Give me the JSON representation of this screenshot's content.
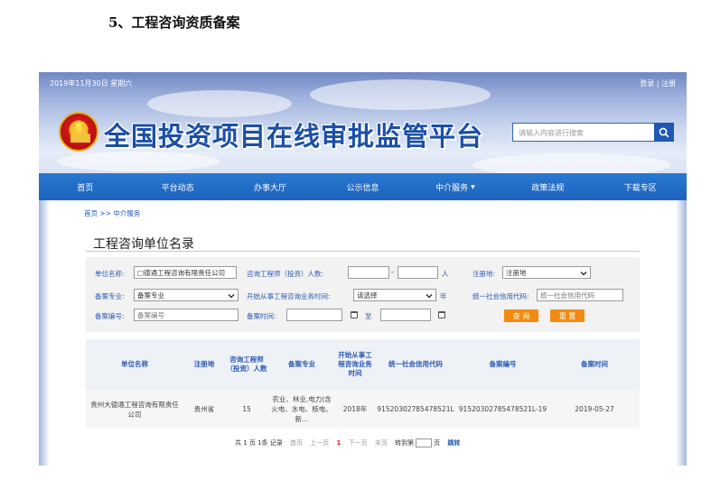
{
  "doc": {
    "heading": "5、工程咨询资质备案"
  },
  "banner": {
    "date": "2019年11月30日 星期六",
    "login": "登录",
    "separator": " | ",
    "register": "注册",
    "site_title": "全国投资项目在线审批监管平台",
    "search_placeholder": "请输入内容进行搜索"
  },
  "nav": {
    "items": [
      "首页",
      "平台动态",
      "办事大厅",
      "公示信息",
      "中介服务",
      "政策法规",
      "下载专区"
    ],
    "dropdown_arrow": "▼"
  },
  "breadcrumb": "首页 >> 中介服务",
  "page_title": "工程咨询单位名录",
  "filters": {
    "unit_name": {
      "label": "单位名称:",
      "value": "□德通工程咨询有限责任公司"
    },
    "engineer_count": {
      "label": "咨询工程师（投资）人数:",
      "dash": "-",
      "unit": "人"
    },
    "reg_place": {
      "label": "注册地:",
      "value": "注册地"
    },
    "filing_major": {
      "label": "备案专业:",
      "value": "备案专业"
    },
    "start_time": {
      "label": "开始从事工程咨询业务时间:",
      "value": "请选择",
      "unit": "年"
    },
    "credit_code": {
      "label": "统一社会信用代码:",
      "placeholder": "统一社会信用代码"
    },
    "filing_no": {
      "label": "备案编号:",
      "placeholder": "备案编号"
    },
    "filing_time": {
      "label": "备案时间:",
      "to": "至"
    },
    "query_button": "查 询",
    "reset_button": "重 置"
  },
  "table": {
    "headers": [
      "单位名称",
      "注册地",
      "咨询工程师（投资）人数",
      "备案专业",
      "开始从事工程咨询业务时间",
      "统一社会信用代码",
      "备案编号",
      "备案时间"
    ],
    "rows": [
      [
        "贵州大德通工程咨询有限责任公司",
        "贵州省",
        "15",
        "农业、林业,电力(含火电、水电、核电、新...",
        "2018年",
        "91520302785478521L",
        "91520302785478521L-19",
        "2019-05-27"
      ]
    ]
  },
  "pager": {
    "summary": "共 1 页 1条 记录",
    "first": "首页",
    "prev": "上一页",
    "current": "1",
    "next": "下一页",
    "last": "末页",
    "jump_label": "转到第",
    "page_suffix": "页",
    "go": "跳转"
  },
  "colors": {
    "nav_blue": "#1c63be",
    "link_blue": "#2b5bb3",
    "button_orange": "#f38b12",
    "current_page_red": "#e02020"
  },
  "icons": {
    "search": "search-icon",
    "calendar": "calendar-icon",
    "emblem": "national-emblem-icon"
  }
}
